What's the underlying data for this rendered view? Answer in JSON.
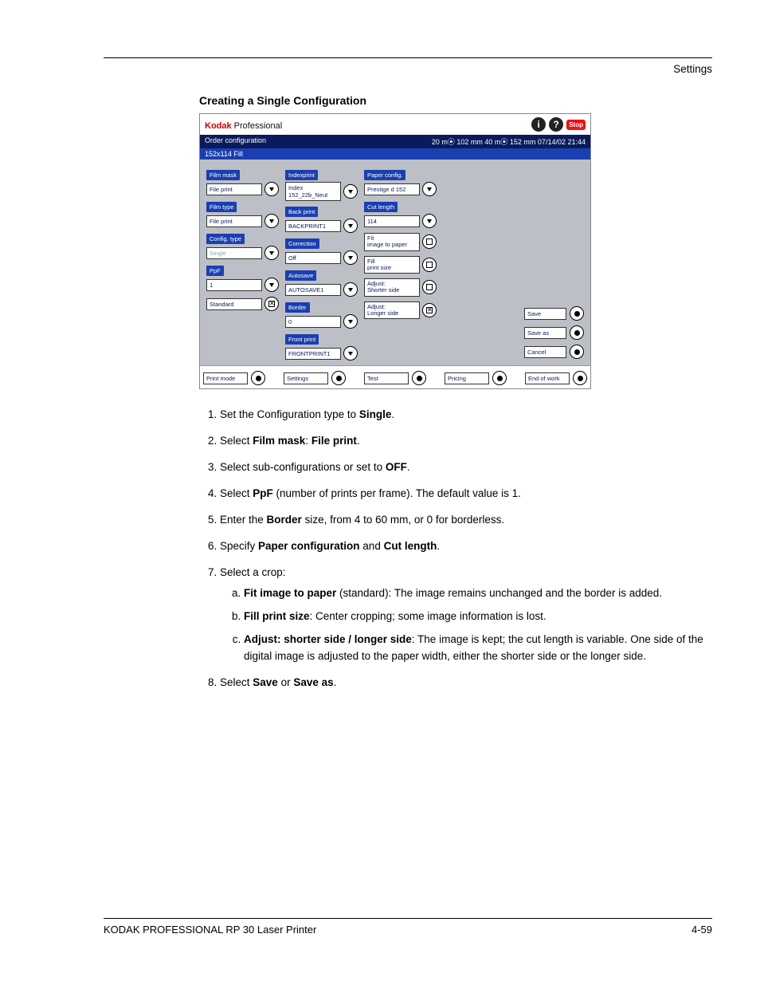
{
  "header": {
    "label": "Settings"
  },
  "section_title": "Creating a Single Configuration",
  "shot": {
    "brand_bold": "Kodak",
    "brand_rest": " Professional",
    "stop": "Stop",
    "bar_left": "Order configuration",
    "bar_right": "20 m⦿ 102 mm   40 m⦿ 152 mm  07/14/02      21:44",
    "bar_config": "152x114  Fill",
    "col1": [
      {
        "label": "Film mask",
        "value": "File print",
        "type": "tri"
      },
      {
        "label": "Film type",
        "value": "File print",
        "type": "tri"
      },
      {
        "label": "Config. type",
        "value": "Single",
        "type": "tri",
        "dim": true
      },
      {
        "label": "PpF",
        "value": "1",
        "type": "tri"
      },
      {
        "label": "",
        "value": "Standard",
        "type": "sqx"
      }
    ],
    "col2": [
      {
        "label": "Indexprint",
        "value": "Index 152_22b_Neut",
        "type": "tri"
      },
      {
        "label": "Back print",
        "value": "BACKPRINT1",
        "type": "tri"
      },
      {
        "label": "Correction",
        "value": "Off",
        "type": "tri"
      },
      {
        "label": "Autosave",
        "value": "AUTOSAVE1",
        "type": "tri"
      },
      {
        "label": "Border",
        "value": "0",
        "type": "tri"
      },
      {
        "label": "Front print",
        "value": "FRONTPRINT1",
        "type": "tri"
      }
    ],
    "col3": [
      {
        "label": "Paper config.",
        "value": "Prestige d 152",
        "type": "tri"
      },
      {
        "label": "Cut length",
        "value": "114",
        "type": "tri"
      },
      {
        "label": "",
        "value": "Fit image to paper",
        "type": "sq",
        "double": true
      },
      {
        "label": "",
        "value": "Fill print size",
        "type": "sq",
        "double": true
      },
      {
        "label": "",
        "value": "Adjust: Shorter side",
        "type": "sq",
        "double": true
      },
      {
        "label": "",
        "value": "Adjust: Longer side",
        "type": "sqx",
        "double": true
      }
    ],
    "col4": [
      {
        "value": "Save"
      },
      {
        "value": "Save as"
      },
      {
        "value": "Cancel"
      }
    ],
    "nav": [
      "Print mode",
      "Settings",
      "Test",
      "Pricing",
      "End of work"
    ]
  },
  "steps": [
    {
      "pre": "Set the Configuration type to ",
      "b": "Single",
      "post": "."
    },
    {
      "pre": "Select ",
      "b": "Film mask",
      "post": ": ",
      "b2": "File print",
      "post2": "."
    },
    {
      "pre": "Select sub-configurations or set to ",
      "b": "OFF",
      "post": "."
    },
    {
      "pre": "Select ",
      "b": "PpF",
      "post": " (number of prints per frame). The default value is 1."
    },
    {
      "pre": "Enter the ",
      "b": "Border",
      "post": " size, from 4 to 60 mm, or 0 for borderless."
    },
    {
      "pre": "Specify ",
      "b": "Paper configuration",
      "post": " and ",
      "b2": "Cut length",
      "post2": "."
    },
    {
      "pre": "Select a crop:",
      "sub": [
        {
          "b": "Fit image to paper",
          "post": " (standard): The image remains unchanged and the border is added."
        },
        {
          "b": "Fill print size",
          "post": ": Center cropping; some image information is lost."
        },
        {
          "b": "Adjust: shorter side / longer side",
          "post": ": The image is kept; the cut length is variable. One side of the digital image is adjusted to the paper width, either the shorter side or the longer side."
        }
      ]
    },
    {
      "pre": "Select ",
      "b": "Save",
      "post": " or ",
      "b2": "Save as",
      "post2": "."
    }
  ],
  "footer": {
    "product": "KODAK PROFESSIONAL RP 30 Laser Printer",
    "page": "4-59"
  }
}
